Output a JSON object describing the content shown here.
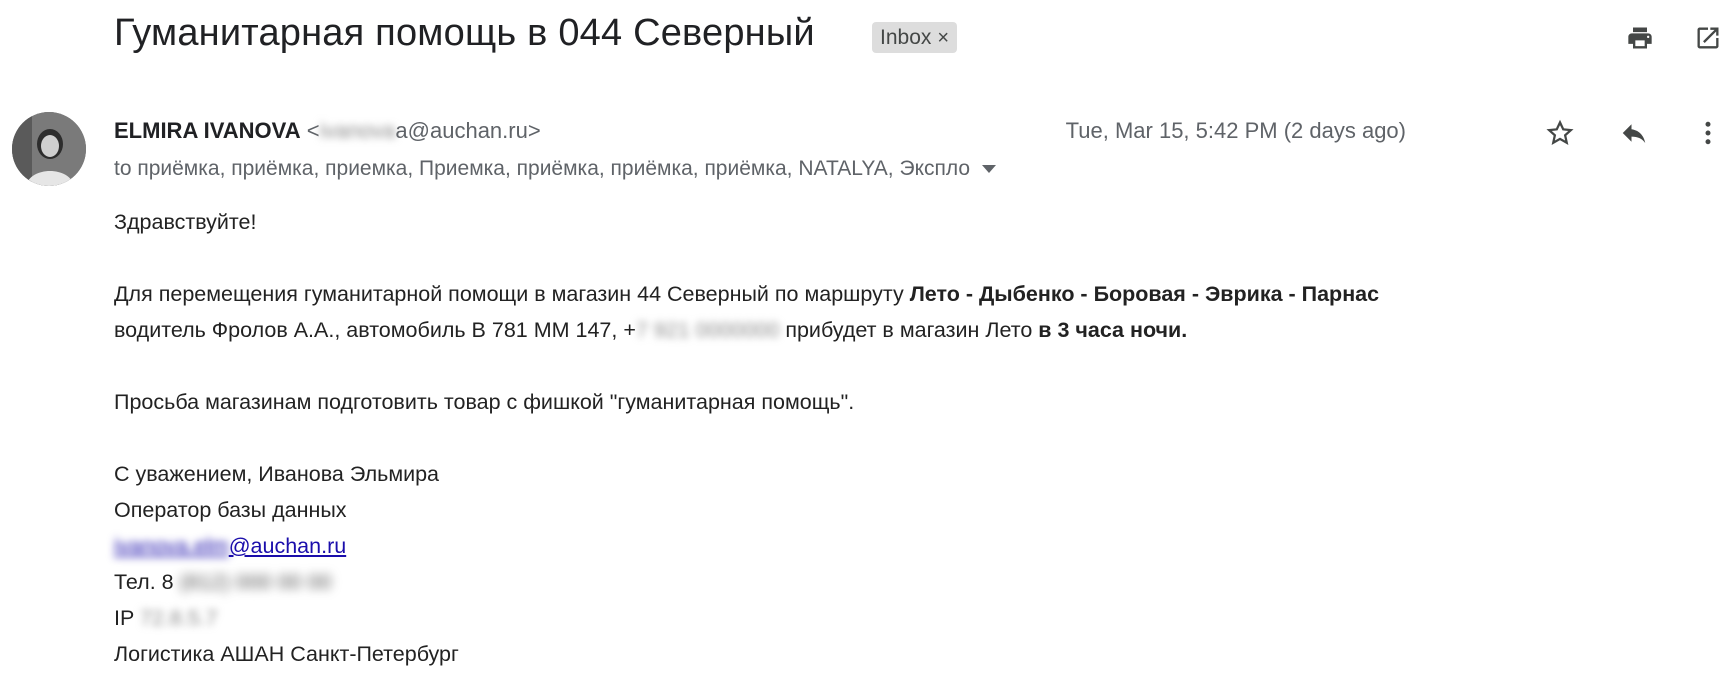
{
  "header": {
    "subject": "Гуманитарная помощь в 044 Северный",
    "label_chip": "Inbox",
    "label_chip_remove": "×",
    "icons": {
      "print": "print-icon",
      "open_new_window": "open-in-new-window-icon"
    }
  },
  "message": {
    "sender_name": "ELMIRA IVANOVA",
    "sender_email_prefix": "<",
    "sender_email_hidden": "ivanova",
    "sender_email_suffix": "a@auchan.ru>",
    "recipients": "to приёмка, приёмка, приемка, Приемка, приёмка, приёмка, приёмка, NATALYA, Экспло",
    "date": "Tue, Mar 15, 5:42 PM (2 days ago)",
    "icons": {
      "star": "star-icon",
      "reply": "reply-icon",
      "more": "more-vert-icon",
      "show_details": "chevron-down-icon"
    }
  },
  "body": {
    "greeting": "Здравствуйте!",
    "p1_text": "Для перемещения гуманитарной помощи в магазин 44 Северный по  маршруту ",
    "p1_route": "Лето - Дыбенко - Боровая - Эврика - Парнас",
    "p2_start": "водитель  Фролов А.А., автомобиль В 781 ММ 147,  +",
    "p2_phone_hidden": "7 921 0000000",
    "p2_mid": " прибудет в магазин Лето ",
    "p2_time": "в 3 часа ночи.",
    "request": "Просьба магазинам подготовить товар с фишкой \"гуманитарная помощь\".",
    "signature": {
      "regards": "С уважением,  Иванова Эльмира",
      "position": "Оператор базы данных",
      "email_hidden": "ivanova.elm",
      "email_visible": "@auchan.ru",
      "phone_label": "Тел. 8 ",
      "phone_hidden": "(812) 000 00 00",
      "ip_label": "IP ",
      "ip_hidden": "72.8.5.7",
      "company": "Логистика АШАН Санкт-Петербург"
    }
  }
}
